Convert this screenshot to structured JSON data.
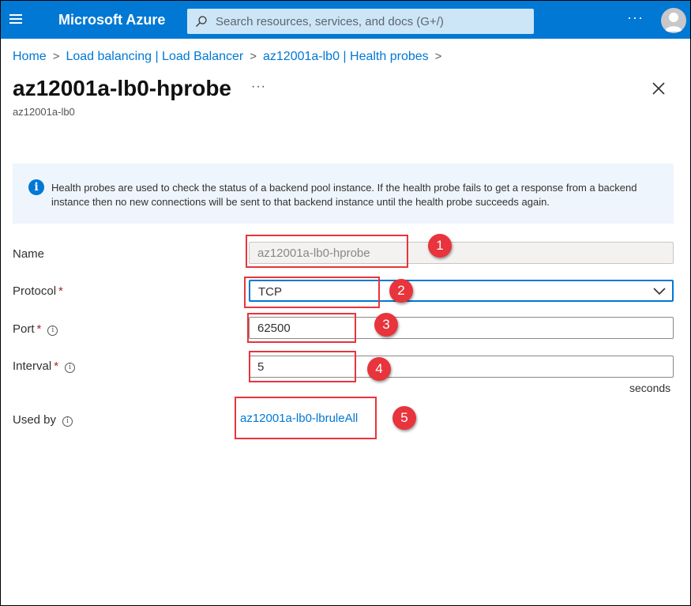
{
  "topbar": {
    "brand": "Microsoft Azure",
    "search_placeholder": "Search resources, services, and docs (G+/)",
    "more": "···"
  },
  "breadcrumb": [
    "Home",
    "Load balancing | Load Balancer",
    "az12001a-lb0 | Health probes"
  ],
  "page": {
    "title": "az12001a-lb0-hprobe",
    "subtitle": "az12001a-lb0",
    "more": "···"
  },
  "info": {
    "icon": "info-icon",
    "text": "Health probes are used to check the status of a backend pool instance. If the health probe fails to get a response from a backend instance then no new connections will be sent to that backend instance until the health probe succeeds again."
  },
  "form": {
    "name_label": "Name",
    "name_value": "az12001a-lb0-hprobe",
    "protocol_label": "Protocol",
    "protocol_value": "TCP",
    "port_label": "Port",
    "port_value": "62500",
    "interval_label": "Interval",
    "interval_value": "5",
    "interval_unit": "seconds",
    "used_by_label": "Used by",
    "used_by_link": "az12001a-lb0-lbruleAll",
    "required_marker": "*"
  },
  "annotations": [
    "1",
    "2",
    "3",
    "4",
    "5"
  ],
  "colors": {
    "accent": "#0078d4",
    "annotation": "#e8343c"
  }
}
